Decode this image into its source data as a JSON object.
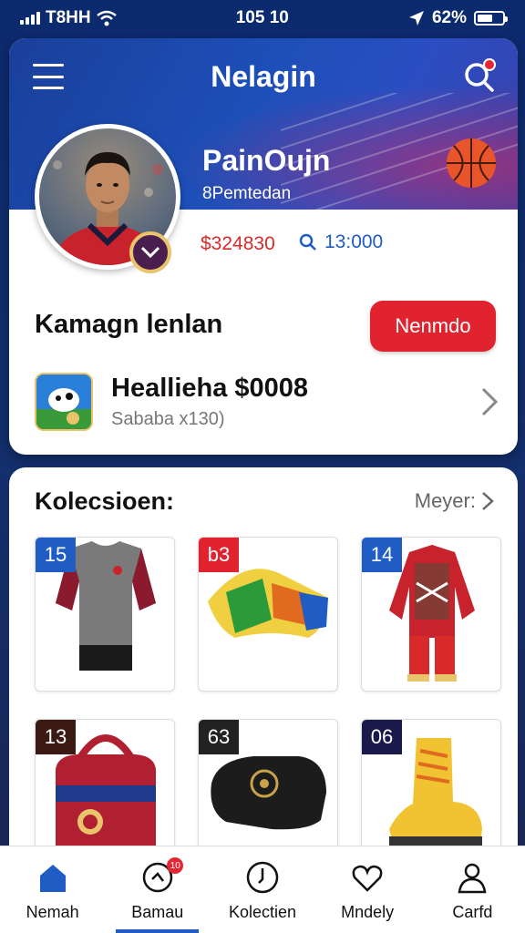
{
  "status_bar": {
    "carrier": "T8HH",
    "time": "105 10",
    "battery_pct": "62%"
  },
  "header": {
    "title": "Nelagin",
    "menu_icon": "hamburger-menu-icon",
    "search_icon": "search-icon"
  },
  "profile": {
    "name": "PainOujn",
    "subtitle": "8Pemtedan",
    "stat_red": "$324830",
    "stat_blue": "13:000"
  },
  "campaign": {
    "title": "Kamagn lenlan",
    "button_label": "Nenmdo"
  },
  "featured_item": {
    "title": "Heallieha $0008",
    "subtitle": "Sababa x130)"
  },
  "collection": {
    "title": "Kolecsioen:",
    "see_more": "Meyer:",
    "items": [
      {
        "badge": "15",
        "badge_color": "#1f5cc4",
        "icon": "jersey-icon"
      },
      {
        "badge": "b3",
        "badge_color": "#e0232e",
        "icon": "scarf-icon"
      },
      {
        "badge": "14",
        "badge_color": "#1f5cc4",
        "icon": "kit-icon"
      },
      {
        "badge": "13",
        "badge_color": "#3a1a12",
        "icon": "bag-icon"
      },
      {
        "badge": "63",
        "badge_color": "#222222",
        "icon": "wallet-icon"
      },
      {
        "badge": "06",
        "badge_color": "#1a1a4a",
        "icon": "boot-icon"
      }
    ]
  },
  "nav": {
    "items": [
      {
        "label": "Nemah",
        "icon": "home-icon"
      },
      {
        "label": "Bamau",
        "icon": "chat-icon",
        "badge": "10"
      },
      {
        "label": "Kolectien",
        "icon": "clock-icon"
      },
      {
        "label": "Mndely",
        "icon": "heart-icon"
      },
      {
        "label": "Carfd",
        "icon": "user-icon"
      }
    ]
  },
  "colors": {
    "primary_blue": "#1f5cc4",
    "accent_red": "#e0232e"
  }
}
